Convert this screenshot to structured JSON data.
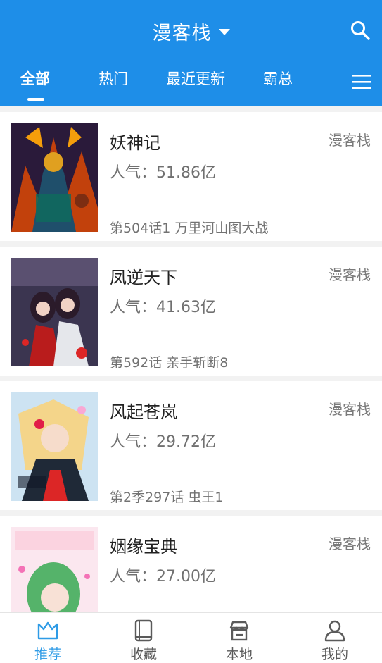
{
  "header": {
    "title": "漫客栈"
  },
  "tabs": [
    {
      "label": "全部"
    },
    {
      "label": "热门"
    },
    {
      "label": "最近更新"
    },
    {
      "label": "霸总"
    }
  ],
  "comics": [
    {
      "name": "妖神记",
      "source": "漫客栈",
      "pop_label": "人气：",
      "popularity": "51.86亿",
      "chapter": "第504话1 万里河山图大战"
    },
    {
      "name": "凤逆天下",
      "source": "漫客栈",
      "pop_label": "人气：",
      "popularity": "41.63亿",
      "chapter": "第592话 亲手斩断8"
    },
    {
      "name": "风起苍岚",
      "source": "漫客栈",
      "pop_label": "人气：",
      "popularity": "29.72亿",
      "chapter": "第2季297话 虫王1"
    },
    {
      "name": "姻缘宝典",
      "source": "漫客栈",
      "pop_label": "人气：",
      "popularity": "27.00亿",
      "chapter": ""
    }
  ],
  "bottom_nav": [
    {
      "label": "推荐",
      "icon": "crown-icon",
      "active": true
    },
    {
      "label": "收藏",
      "icon": "book-icon",
      "active": false
    },
    {
      "label": "本地",
      "icon": "store-icon",
      "active": false
    },
    {
      "label": "我的",
      "icon": "user-icon",
      "active": false
    }
  ],
  "colors": {
    "brand": "#1e8ee8",
    "active_nav": "#2e9be6"
  }
}
